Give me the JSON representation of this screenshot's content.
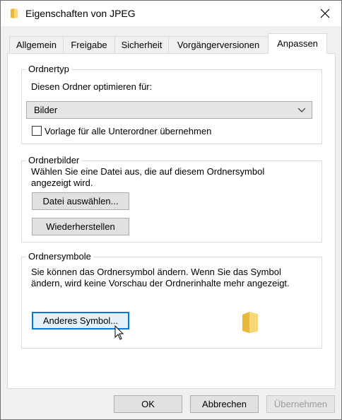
{
  "window": {
    "title": "Eigenschaften von JPEG"
  },
  "tabs": [
    {
      "label": "Allgemein"
    },
    {
      "label": "Freigabe"
    },
    {
      "label": "Sicherheit"
    },
    {
      "label": "Vorgängerversionen"
    },
    {
      "label": "Anpassen"
    }
  ],
  "ordnertyp": {
    "group_title": "Ordnertyp",
    "label": "Diesen Ordner optimieren für:",
    "select_value": "Bilder",
    "checkbox_label": "Vorlage für alle Unterordner übernehmen"
  },
  "ordnerbilder": {
    "group_title": "Ordnerbilder",
    "description_line1": "Wählen Sie eine Datei aus, die auf diesem Ordnersymbol",
    "description_line2": "angezeigt wird.",
    "choose_file_button": "Datei auswählen...",
    "restore_button": "Wiederherstellen"
  },
  "ordnersymbole": {
    "group_title": "Ordnersymbole",
    "description_line1": "Sie können das Ordnersymbol ändern. Wenn Sie das Symbol",
    "description_line2": "ändern, wird keine Vorschau der Ordnerinhalte mehr angezeigt.",
    "change_icon_button": "Anderes Symbol..."
  },
  "footer": {
    "ok": "OK",
    "cancel": "Abbrechen",
    "apply": "Übernehmen"
  },
  "icons": {
    "title": "folder-icon",
    "close": "close-icon",
    "dropdown": "chevron-down-icon",
    "preview": "folder-preview-icon",
    "cursor": "mouse-pointer-icon"
  },
  "colors": {
    "focus_border": "#0078d7",
    "folder_yellow": "#f8d775"
  }
}
